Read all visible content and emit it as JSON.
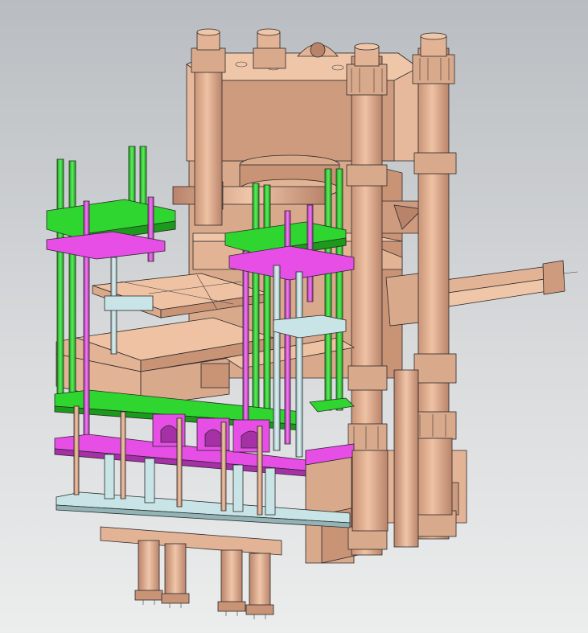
{
  "view": {
    "background": [
      "#b9bdc1",
      "#eceded"
    ]
  },
  "colors": {
    "frame": "#e3b395",
    "frame_shade": "#c99376",
    "frame_dark": "#a9765b",
    "green": "#2fd62f",
    "green_dark": "#1b9a1b",
    "magenta": "#e64ee6",
    "magenta_dark": "#a630a6",
    "cyan": "#c9e4e6",
    "cyan_dark": "#93b4b6",
    "edge": "#2a2a2a"
  }
}
